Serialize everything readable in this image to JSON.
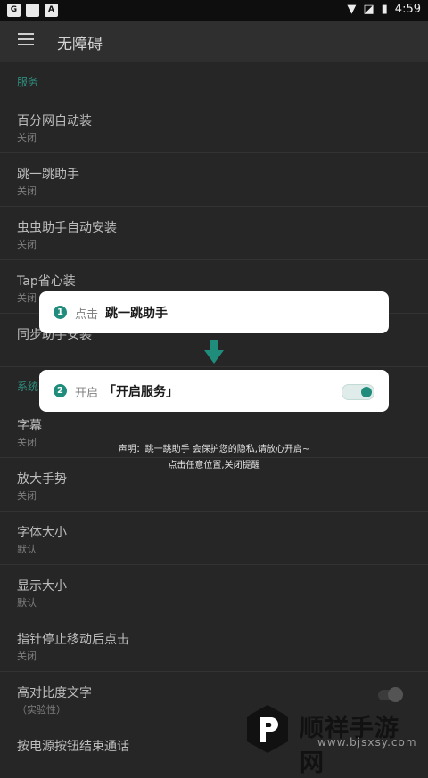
{
  "status_bar": {
    "time": "4:59"
  },
  "app_bar": {
    "title": "无障碍"
  },
  "sections": {
    "services": "服务",
    "system": "系统"
  },
  "service_items": [
    {
      "title": "百分网自动装",
      "status": "关闭"
    },
    {
      "title": "跳一跳助手",
      "status": "关闭"
    },
    {
      "title": "虫虫助手自动安装",
      "status": "关闭"
    },
    {
      "title": "Tap省心装",
      "status": "关闭"
    },
    {
      "title": "同步助手安装",
      "status": ""
    }
  ],
  "system_items": [
    {
      "title": "字幕",
      "status": "关闭"
    },
    {
      "title": "放大手势",
      "status": "关闭"
    },
    {
      "title": "字体大小",
      "status": "默认"
    },
    {
      "title": "显示大小",
      "status": "默认"
    },
    {
      "title": "指针停止移动后点击",
      "status": "关闭"
    },
    {
      "title": "高对比度文字",
      "status": "（实验性）"
    },
    {
      "title": "按电源按钮结束通话",
      "status": ""
    }
  ],
  "guide": {
    "step1": {
      "number": "1",
      "verb": "点击",
      "target": "跳一跳助手"
    },
    "step2": {
      "number": "2",
      "verb": "开启",
      "target": "「开启服务」"
    },
    "note_line1": "声明：跳一跳助手 会保护您的隐私,请放心开启~",
    "note_line2": "点击任意位置,关闭提醒"
  },
  "watermark": {
    "name": "顺祥手游网",
    "url": "www.bjsxsy.com"
  },
  "colors": {
    "accent": "#1f8c7c",
    "section_text": "#2e8f7f"
  }
}
